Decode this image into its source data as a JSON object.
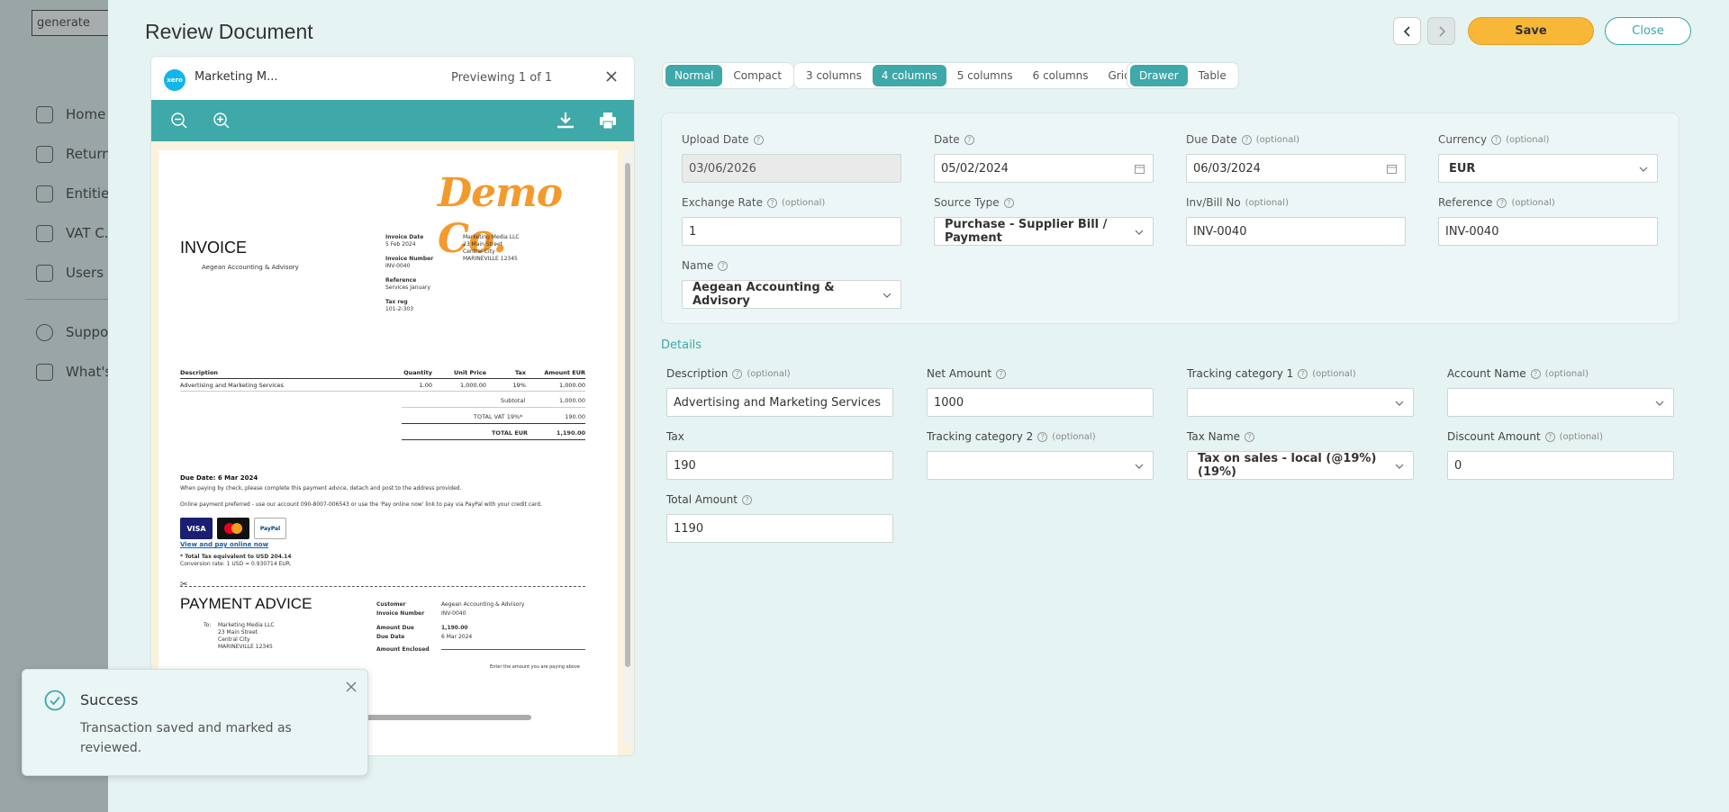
{
  "app": {
    "logo_text": "generate",
    "nav": [
      "Home",
      "Returns",
      "Entities",
      "VAT C...",
      "Users"
    ],
    "nav_secondary": [
      "Support",
      "What's"
    ]
  },
  "drawer": {
    "title": "Review Document",
    "save_label": "Save",
    "close_label": "Close"
  },
  "preview": {
    "file_name": "Marketing M...",
    "count": "Previewing 1 of 1",
    "source_badge": "xero"
  },
  "invoice": {
    "logo": "Demo Co.",
    "title": "INVOICE",
    "to": "Aegean Accounting & Advisory",
    "invoice_date_label": "Invoice Date",
    "invoice_date": "5 Feb 2024",
    "invoice_number_label": "Invoice Number",
    "invoice_number": "INV-0040",
    "reference_label": "Reference",
    "reference": "Services January",
    "tax_reg_label": "Tax reg",
    "tax_reg": "101-2-303",
    "from_lines": [
      "Marketing Media LLC",
      "23 Main Street",
      "Central City",
      "MARINEVILLE 12345"
    ],
    "headers": [
      "Description",
      "Quantity",
      "Unit Price",
      "Tax",
      "Amount EUR"
    ],
    "line": [
      "Advertising and Marketing Services",
      "1.00",
      "1,000.00",
      "19%",
      "1,000.00"
    ],
    "subtotal_label": "Subtotal",
    "subtotal": "1,000.00",
    "vat_label": "TOTAL VAT 19%*",
    "vat": "190.00",
    "total_label": "TOTAL EUR",
    "total": "1,190.00",
    "due": "Due Date: 6 Mar 2024",
    "note1": "When paying by check, please complete this payment advice, detach and post to the address provided.",
    "note2": "Online payment preferred - use our account 090-8007-006543 or use the 'Pay online now' link to pay via PayPal with your credit card.",
    "pay_link": "View and pay online now",
    "tax_equiv": "* Total Tax equivalent to USD 204.14",
    "conversion": "Conversion rate: 1 USD = 0.930714 EUR.",
    "payment_advice": "PAYMENT ADVICE",
    "pa_to_label": "To:",
    "pa_to": [
      "Marketing Media LLC",
      "23 Main Street",
      "Central City",
      "MARINEVILLE 12345"
    ],
    "pa_customer_label": "Customer",
    "pa_customer": "Aegean Accounting & Advisory",
    "pa_invoice_label": "Invoice Number",
    "pa_invoice": "INV-0040",
    "pa_amount_due_label": "Amount Due",
    "pa_amount_due": "1,190.00",
    "pa_due_date_label": "Due Date",
    "pa_due_date": "6 Mar 2024",
    "pa_enclosed_label": "Amount Enclosed",
    "pa_enclosed_hint": "Enter the amount you are paying above",
    "card_labels": [
      "VISA",
      "PayPal"
    ]
  },
  "view_controls": {
    "density": [
      "Normal",
      "Compact"
    ],
    "columns": [
      "3 columns",
      "4 columns",
      "5 columns",
      "6 columns",
      "Grid"
    ],
    "mode": [
      "Drawer",
      "Table"
    ]
  },
  "optional_tag": "(optional)",
  "form": {
    "upload_date": {
      "label": "Upload Date",
      "value": "03/06/2026"
    },
    "date": {
      "label": "Date",
      "value": "05/02/2024"
    },
    "due_date": {
      "label": "Due Date",
      "value": "06/03/2024"
    },
    "currency": {
      "label": "Currency",
      "value": "EUR"
    },
    "exchange_rate": {
      "label": "Exchange Rate",
      "value": "1"
    },
    "source_type": {
      "label": "Source Type",
      "value": "Purchase - Supplier Bill / Payment"
    },
    "inv_bill_no": {
      "label": "Inv/Bill No",
      "value": "INV-0040"
    },
    "reference": {
      "label": "Reference",
      "value": "INV-0040"
    },
    "name": {
      "label": "Name",
      "value": "Aegean Accounting & Advisory"
    }
  },
  "details": {
    "title": "Details",
    "description": {
      "label": "Description",
      "value": "Advertising and Marketing Services"
    },
    "net_amount": {
      "label": "Net Amount",
      "value": "1000"
    },
    "tracking1": {
      "label": "Tracking category 1",
      "value": ""
    },
    "account_name": {
      "label": "Account Name",
      "value": ""
    },
    "tax": {
      "label": "Tax",
      "value": "190"
    },
    "tracking2": {
      "label": "Tracking category 2",
      "value": ""
    },
    "tax_name": {
      "label": "Tax Name",
      "value": "Tax on sales - local (@19%) (19%)"
    },
    "discount": {
      "label": "Discount Amount",
      "value": "0"
    },
    "total": {
      "label": "Total Amount",
      "value": "1190"
    }
  },
  "toast": {
    "title": "Success",
    "message": "Transaction saved and marked as reviewed."
  },
  "colors": {
    "accent": "#3fa8a8",
    "save": "#f8b737",
    "brand_orange": "#f39a2c"
  }
}
